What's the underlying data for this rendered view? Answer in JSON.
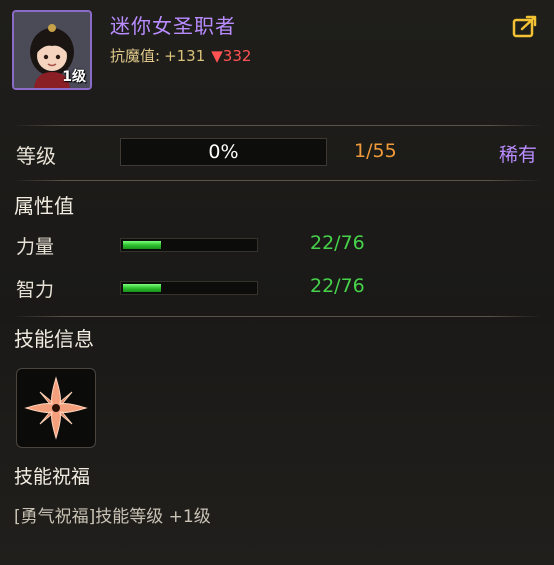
{
  "hero": {
    "name": "迷你女圣职者",
    "avatar_level": "1级",
    "resist_label": "抗魔值:",
    "resist_plus": "+131",
    "resist_down": "▼332"
  },
  "level": {
    "label": "等级",
    "progress_text": "0%",
    "progress": 0,
    "count": "1/55",
    "rarity": "稀有"
  },
  "attributes": {
    "title": "属性值",
    "items": [
      {
        "label": "力量",
        "value": "22/76",
        "fill": 0.29
      },
      {
        "label": "智力",
        "value": "22/76",
        "fill": 0.29
      }
    ]
  },
  "skill": {
    "section_title": "技能信息",
    "icon": "four-point-star-icon",
    "name": "技能祝福",
    "description": "[勇气祝福]技能等级 +1级"
  },
  "colors": {
    "name": "#b98cff",
    "count": "#f09a3a",
    "stat_value": "#46d24a",
    "resist_down": "#ff5252"
  }
}
